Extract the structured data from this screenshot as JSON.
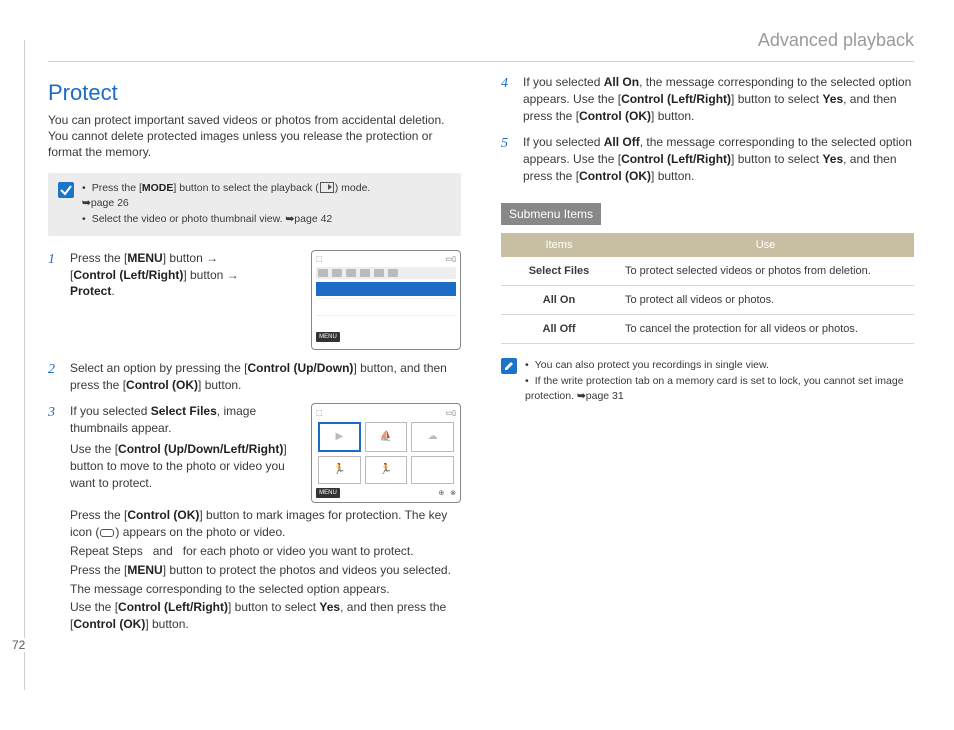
{
  "page_number": "72",
  "header": {
    "title": "Advanced playback"
  },
  "left": {
    "title": "Protect",
    "intro": "You can protect important saved videos or photos from accidental deletion. You cannot delete protected images unless you release the protection or format the memory.",
    "note": [
      {
        "pre": "Press the",
        "b1": "MODE",
        "mid": "button to select the playback",
        "post": "mode.",
        "ref": "page 26"
      },
      {
        "text": "Select the video or photo thumbnail view.",
        "ref": "page 42"
      }
    ],
    "screen1": {
      "menu": "MENU"
    },
    "screen2": {
      "menu": "MENU"
    },
    "steps": [
      {
        "num": "1",
        "t1": "Press the",
        "b1": "MENU",
        "t2": "button",
        "b2": "Control (Left/Right)",
        "t3": "button",
        "b3": "Protect"
      },
      {
        "num": "2",
        "t1": "Select an option by pressing the",
        "b1": "Control (Up/Down)",
        "t2": "button, and then press the",
        "b2": "Control (OK)",
        "t3": "button."
      },
      {
        "num": "3",
        "t1": "If you selected",
        "b1": "Select Files",
        "t2": ", image thumbnails appear.",
        "sub": [
          {
            "t1": "Use the",
            "b1": "Control (Up/Down/Left/Right)",
            "t2": "button to move to the photo or video you want to protect."
          },
          {
            "t1": "Press the",
            "b1": "Control (OK)",
            "t2": "button to mark images for protection. The key icon",
            "t3": "appears on the photo or video."
          },
          {
            "t1": "Repeat Steps   and   for each photo or video you want to protect."
          },
          {
            "t1": "Press the",
            "b1": "MENU",
            "t2": "button to protect the photos and videos you selected."
          },
          {
            "t1": "The message corresponding to the selected option appears."
          },
          {
            "t1": "Use the",
            "b1": "Control (Left/Right)",
            "t2": "button to select",
            "b2": "Yes",
            "t3": ", and then press the",
            "b3": "Control (OK)",
            "t4": "button."
          }
        ]
      }
    ]
  },
  "right": {
    "steps": [
      {
        "num": "4",
        "t1": "If you selected",
        "b1": "All On",
        "t2": ", the message corresponding to the selected option appears. Use the",
        "b2": "Control (Left/Right)",
        "t3": "button to select",
        "b3": "Yes",
        "t4": ", and then press the",
        "b4": "Control (OK)",
        "t5": "button."
      },
      {
        "num": "5",
        "t1": "If you selected",
        "b1": "All Off",
        "t2": ", the message corresponding to the selected option appears. Use the",
        "b2": "Control (Left/Right)",
        "t3": "button to select",
        "b3": "Yes",
        "t4": ", and then press the",
        "b4": "Control (OK)",
        "t5": "button."
      }
    ],
    "submenu_heading": "Submenu Items",
    "table": {
      "headers": [
        "Items",
        "Use"
      ],
      "rows": [
        {
          "item": "Select Files",
          "use": "To protect selected videos or photos from deletion."
        },
        {
          "item": "All On",
          "use": "To protect all videos or photos."
        },
        {
          "item": "All Off",
          "use": "To cancel the protection for all videos or photos."
        }
      ]
    },
    "info": [
      "You can also protect you recordings in single view.",
      {
        "t": "If the write protection tab on a memory card is set to lock, you cannot set image protection.",
        "ref": "page 31"
      }
    ]
  }
}
